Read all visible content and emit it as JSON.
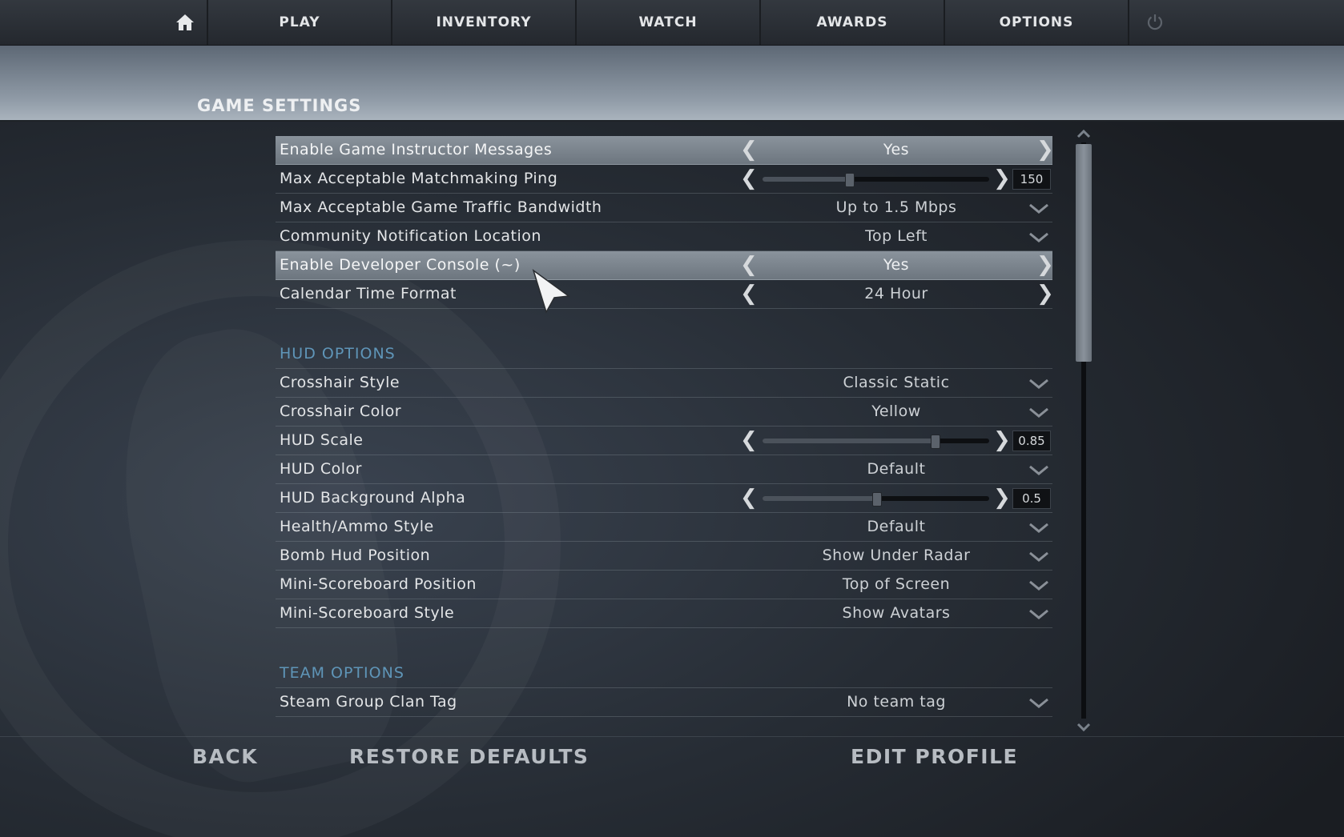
{
  "nav": {
    "home_icon": "home-icon",
    "items": [
      "PLAY",
      "INVENTORY",
      "WATCH",
      "AWARDS",
      "OPTIONS"
    ],
    "power_icon": "power-icon"
  },
  "page": {
    "title": "GAME SETTINGS"
  },
  "game_settings": [
    {
      "label": "Enable Game Instructor Messages",
      "control": "cycle",
      "value": "Yes",
      "highlight": true
    },
    {
      "label": "Max Acceptable Matchmaking Ping",
      "control": "slider",
      "value": "150",
      "fraction": 0.38
    },
    {
      "label": "Max Acceptable Game Traffic Bandwidth",
      "control": "dropdown",
      "value": "Up to 1.5 Mbps"
    },
    {
      "label": "Community Notification Location",
      "control": "dropdown",
      "value": "Top Left"
    },
    {
      "label": "Enable Developer Console (~)",
      "control": "cycle",
      "value": "Yes",
      "highlight": true
    },
    {
      "label": "Calendar Time Format",
      "control": "cycle",
      "value": "24 Hour"
    }
  ],
  "hud": {
    "title": "HUD OPTIONS",
    "rows": [
      {
        "label": "Crosshair Style",
        "control": "dropdown",
        "value": "Classic Static"
      },
      {
        "label": "Crosshair Color",
        "control": "dropdown",
        "value": "Yellow"
      },
      {
        "label": "HUD Scale",
        "control": "slider",
        "value": "0.85",
        "fraction": 0.76
      },
      {
        "label": "HUD Color",
        "control": "dropdown",
        "value": "Default"
      },
      {
        "label": "HUD Background Alpha",
        "control": "slider",
        "value": "0.5",
        "fraction": 0.5
      },
      {
        "label": "Health/Ammo Style",
        "control": "dropdown",
        "value": "Default"
      },
      {
        "label": "Bomb Hud Position",
        "control": "dropdown",
        "value": "Show Under Radar"
      },
      {
        "label": "Mini-Scoreboard Position",
        "control": "dropdown",
        "value": "Top of Screen"
      },
      {
        "label": "Mini-Scoreboard Style",
        "control": "dropdown",
        "value": "Show Avatars"
      }
    ]
  },
  "team": {
    "title": "TEAM OPTIONS",
    "rows": [
      {
        "label": "Steam Group Clan Tag",
        "control": "dropdown",
        "value": "No team tag"
      }
    ]
  },
  "footer": {
    "back": "BACK",
    "restore": "RESTORE DEFAULTS",
    "edit_profile": "EDIT PROFILE"
  },
  "colors": {
    "section_title": "#5f95b8",
    "highlight_row": "#7d868f",
    "text": "#e3e5e7"
  }
}
